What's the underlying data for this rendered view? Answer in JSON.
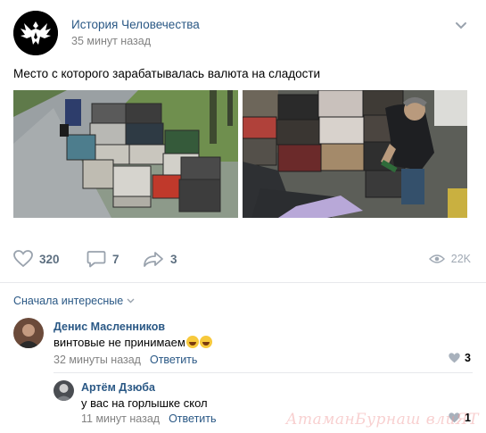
{
  "post": {
    "group_name": "История Человечества",
    "time": "35 минут назад",
    "text": "Место с которого зарабатывалась валюта на сладости",
    "images": [
      "photo-crates-park",
      "photo-man-collecting-bottles"
    ]
  },
  "actions": {
    "likes": "320",
    "comments": "7",
    "shares": "3",
    "views": "22K"
  },
  "comments_section": {
    "sort_label": "Сначала интересные",
    "items": [
      {
        "author": "Денис Масленников",
        "text": "винтовые не принимаем",
        "time": "32 минуты назад",
        "reply_label": "Ответить",
        "likes": "3"
      },
      {
        "author": "Артём Дзюба",
        "text": "у вас на горлышке скол",
        "time": "11 минут назад",
        "reply_label": "Ответить",
        "likes": "1"
      }
    ]
  },
  "watermark": "АтаманБурнаш влиЯТ",
  "colors": {
    "link": "#2a5885",
    "meta": "#828282",
    "action": "#5d6f80",
    "divider": "#e7e8ec"
  }
}
